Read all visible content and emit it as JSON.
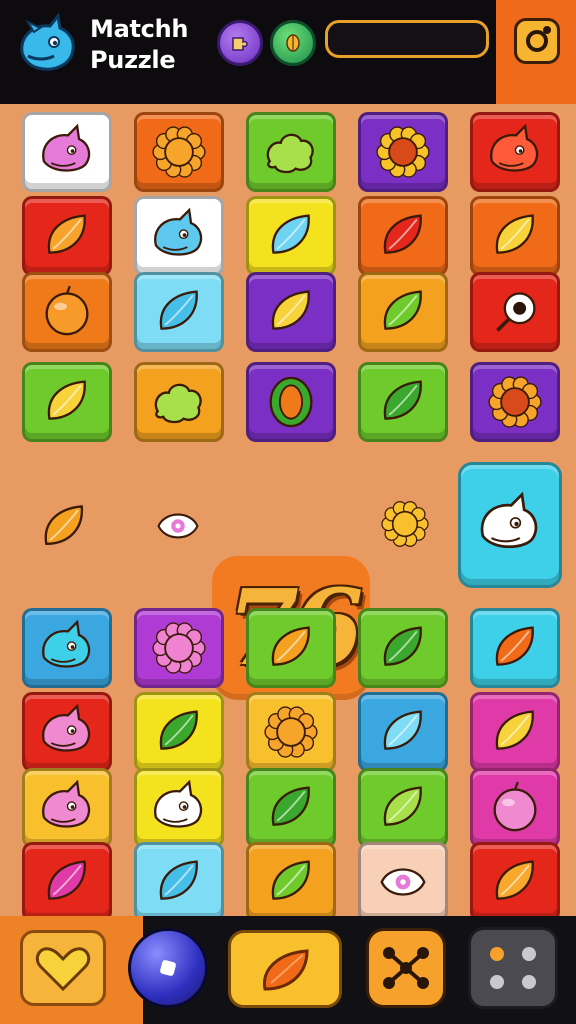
{
  "header": {
    "title_line1": "Matchh",
    "title_line2": "Puzzle",
    "logo_icon": "blue-dragon-icon",
    "currency": [
      {
        "name": "puzzle-coin-icon",
        "color": "#7a3fd0"
      },
      {
        "name": "seed-coin-icon",
        "color": "#2aa456"
      }
    ],
    "progress": 0.0,
    "settings_icon": "settings-icon"
  },
  "board": {
    "score": "76",
    "rows": [
      [
        {
          "icon": "pink-cat-creature-icon",
          "color": "#ffffff",
          "fg": "#e67ad8"
        },
        {
          "icon": "sun-face-icon",
          "color": "#f06a18",
          "fg": "#f6a52a"
        },
        {
          "icon": "green-bush-icon",
          "color": "#6fcb2c",
          "fg": "#a7e04a"
        },
        {
          "icon": "sunflower-icon",
          "color": "#7b2fc4",
          "fg": "#f6c328"
        },
        {
          "icon": "red-spiky-creature-icon",
          "color": "#e5261b",
          "fg": "#ff5a3a"
        }
      ],
      [
        {
          "icon": "orange-leaf-icon",
          "color": "#e5261b",
          "fg": "#f7a22a"
        },
        {
          "icon": "blue-dragon-tile-icon",
          "color": "#ffffff",
          "fg": "#5ec8ef"
        },
        {
          "icon": "cyan-leaf-icon",
          "color": "#f5e21f",
          "fg": "#6fd4f2"
        },
        {
          "icon": "red-leaf-icon",
          "color": "#f06a18",
          "fg": "#e5261b"
        },
        {
          "icon": "yellow-cone-icon",
          "color": "#f06a18",
          "fg": "#f8d23a"
        }
      ],
      [
        {
          "icon": "orange-fruit-icon",
          "color": "#f07a1a",
          "fg": "#f79a2a"
        },
        {
          "icon": "blue-leaf-icon",
          "color": "#7edcf4",
          "fg": "#46bfe8"
        },
        {
          "icon": "yellow-banana-leaf-icon",
          "color": "#7b2fc4",
          "fg": "#f8d23a"
        },
        {
          "icon": "green-leaf-icon",
          "color": "#f3a11f",
          "fg": "#6fcb2c"
        },
        {
          "icon": "alarm-clock-icon",
          "color": "#e5261b",
          "fg": "#ffffff"
        }
      ],
      [
        {
          "icon": "yellow-leaf-icon",
          "color": "#6fcb2c",
          "fg": "#f8d23a"
        },
        {
          "icon": "lime-bush-icon",
          "color": "#f3a11f",
          "fg": "#a7e04a"
        },
        {
          "icon": "seed-pod-icon",
          "color": "#7b2fc4",
          "fg": "#f07a1a"
        },
        {
          "icon": "green-leaf-icon",
          "color": "#6fcb2c",
          "fg": "#3aa82c"
        },
        {
          "icon": "sunflower-icon",
          "color": "#7b2fc4",
          "fg": "#f6a52a"
        }
      ],
      [
        {
          "icon": "pink-cat-creature-icon",
          "color": "#3aa7e0",
          "fg": "#3ed0e8"
        },
        {
          "icon": "pink-flower-creature-icon",
          "color": "#b03ad4",
          "fg": "#f082d2"
        },
        {
          "icon": "orange-leaf-icon",
          "color": "#6fcb2c",
          "fg": "#f3a11f"
        },
        {
          "icon": "green-leaf-icon",
          "color": "#6fcb2c",
          "fg": "#3aa82c"
        },
        {
          "icon": "red-leaf-icon",
          "color": "#3ed0e8",
          "fg": "#f06a18"
        }
      ],
      [
        {
          "icon": "pink-spiky-creature-icon",
          "color": "#e5261b",
          "fg": "#f08ad0"
        },
        {
          "icon": "green-leaf-icon",
          "color": "#f5e21f",
          "fg": "#3aa82c"
        },
        {
          "icon": "yellow-star-bush-icon",
          "color": "#f8c02c",
          "fg": "#f6a52a"
        },
        {
          "icon": "blue-leaf-icon",
          "color": "#3aa7e0",
          "fg": "#7edcf4"
        },
        {
          "icon": "yellow-cone-icon",
          "color": "#e03aa8",
          "fg": "#f8d23a"
        }
      ],
      [
        {
          "icon": "pink-cat-creature-icon",
          "color": "#f8c02c",
          "fg": "#f08ad0"
        },
        {
          "icon": "white-flame-creature-icon",
          "color": "#f5e21f",
          "fg": "#ffffff"
        },
        {
          "icon": "green-leaf-icon",
          "color": "#6fcb2c",
          "fg": "#3aa82c"
        },
        {
          "icon": "green-leaf-icon",
          "color": "#6fcb2c",
          "fg": "#a7e04a"
        },
        {
          "icon": "pink-round-creature-icon",
          "color": "#e03aa8",
          "fg": "#f08ad0"
        }
      ],
      [
        {
          "icon": "magenta-leaf-icon",
          "color": "#e5261b",
          "fg": "#e03aa8"
        },
        {
          "icon": "blue-leaf-icon",
          "color": "#7edcf4",
          "fg": "#46bfe8"
        },
        {
          "icon": "striped-leaf-icon",
          "color": "#f3a11f",
          "fg": "#6fcb2c"
        },
        {
          "icon": "eye-creature-icon",
          "color": "#f8d0b8",
          "fg": "#ffffff"
        },
        {
          "icon": "orange-cone-icon",
          "color": "#e5261b",
          "fg": "#f8a82a"
        }
      ]
    ],
    "special_row": [
      {
        "icon": "orange-feather-leaf-icon",
        "color": "#f3a11f"
      },
      {
        "icon": "pink-eye-bubble-icon",
        "color": "#ffffff"
      },
      {
        "icon": "yellow-flower-bud-icon",
        "color": "#f8c02c"
      },
      {
        "icon": "white-flame-creature-icon",
        "color": "#3ed0e8"
      }
    ]
  },
  "toolbar": {
    "buttons": [
      {
        "icon": "heart-icon",
        "color": "#f8d23a"
      },
      {
        "icon": "blue-orb-icon",
        "color": "#3a3ae0"
      },
      {
        "icon": "orange-leaf-icon",
        "color": "#f06a18"
      },
      {
        "icon": "cookie-icon",
        "color": "#f6a12c"
      },
      {
        "icon": "dice-icon",
        "color": "#4a4a50"
      }
    ]
  }
}
